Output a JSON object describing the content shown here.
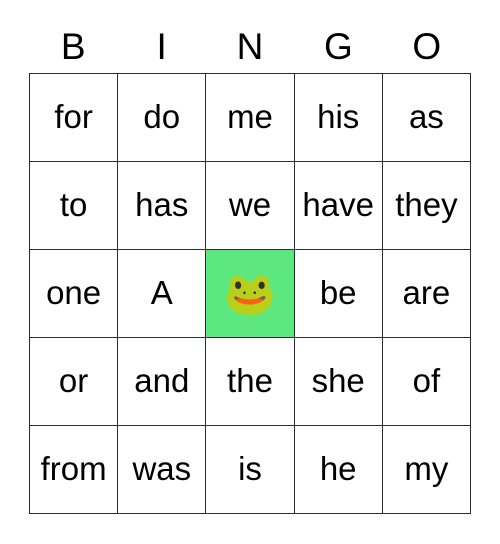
{
  "card": {
    "header": {
      "letters": [
        "B",
        "I",
        "N",
        "G",
        "O"
      ]
    },
    "free_space": {
      "icon": "frog-face-icon",
      "glyph": "🐸",
      "background_color": "#5ce87e"
    },
    "colors": {
      "page_background": "#ffffff",
      "cell_background": "#ffffff",
      "grid_line": "#2b2b2b",
      "text": "#000000",
      "free_space_highlight": "#5ce87e"
    },
    "rows": [
      {
        "cells": [
          {
            "text": "for",
            "marked": false
          },
          {
            "text": "do",
            "marked": false
          },
          {
            "text": "me",
            "marked": false
          },
          {
            "text": "his",
            "marked": false
          },
          {
            "text": "as",
            "marked": false
          }
        ]
      },
      {
        "cells": [
          {
            "text": "to",
            "marked": false
          },
          {
            "text": "has",
            "marked": false
          },
          {
            "text": "we",
            "marked": false
          },
          {
            "text": "have",
            "marked": false
          },
          {
            "text": "they",
            "marked": false
          }
        ]
      },
      {
        "cells": [
          {
            "text": "one",
            "marked": false
          },
          {
            "text": "A",
            "marked": false
          },
          {
            "text": "🐸",
            "marked": true
          },
          {
            "text": "be",
            "marked": false
          },
          {
            "text": "are",
            "marked": false
          }
        ]
      },
      {
        "cells": [
          {
            "text": "or",
            "marked": false
          },
          {
            "text": "and",
            "marked": false
          },
          {
            "text": "the",
            "marked": false
          },
          {
            "text": "she",
            "marked": false
          },
          {
            "text": "of",
            "marked": false
          }
        ]
      },
      {
        "cells": [
          {
            "text": "from",
            "marked": false
          },
          {
            "text": "was",
            "marked": false
          },
          {
            "text": "is",
            "marked": false
          },
          {
            "text": "he",
            "marked": false
          },
          {
            "text": "my",
            "marked": false
          }
        ]
      }
    ]
  }
}
